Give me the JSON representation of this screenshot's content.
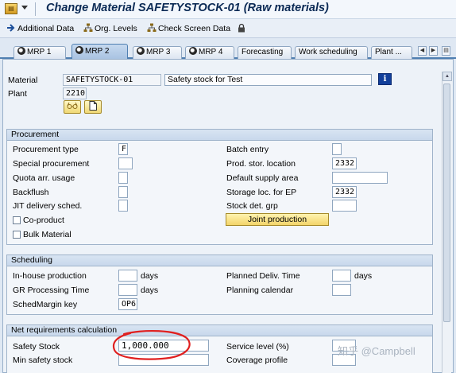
{
  "window": {
    "title": "Change Material SAFETYSTOCK-01 (Raw materials)"
  },
  "toolbar": {
    "additional_data": "Additional Data",
    "org_levels": "Org. Levels",
    "check_screen_data": "Check Screen Data"
  },
  "tabs": [
    {
      "label": "MRP 1",
      "active": false,
      "ok": true
    },
    {
      "label": "MRP 2",
      "active": true,
      "ok": true
    },
    {
      "label": "MRP 3",
      "active": false,
      "ok": true
    },
    {
      "label": "MRP 4",
      "active": false,
      "ok": true
    },
    {
      "label": "Forecasting",
      "active": false,
      "ok": false
    },
    {
      "label": "Work scheduling",
      "active": false,
      "ok": false
    },
    {
      "label": "Plant ...",
      "active": false,
      "ok": false
    }
  ],
  "header": {
    "material_label": "Material",
    "material_value": "SAFETYSTOCK-01",
    "material_desc": "Safety stock for Test",
    "plant_label": "Plant",
    "plant_value": "2210"
  },
  "procurement": {
    "title": "Procurement",
    "procurement_type_label": "Procurement type",
    "procurement_type_value": "F",
    "special_procurement_label": "Special procurement",
    "special_procurement_value": "",
    "quota_label": "Quota arr. usage",
    "quota_value": "",
    "backflush_label": "Backflush",
    "backflush_value": "",
    "jit_label": "JIT delivery sched.",
    "jit_value": "",
    "coproduct_label": "Co-product",
    "bulk_label": "Bulk Material",
    "batch_entry_label": "Batch entry",
    "batch_entry_value": "",
    "prod_stor_label": "Prod. stor. location",
    "prod_stor_value": "2332",
    "default_supply_label": "Default supply area",
    "default_supply_value": "",
    "storage_loc_ep_label": "Storage loc. for EP",
    "storage_loc_ep_value": "2332",
    "stock_det_label": "Stock det. grp",
    "stock_det_value": "",
    "joint_production_button": "Joint production"
  },
  "scheduling": {
    "title": "Scheduling",
    "inhouse_label": "In-house production",
    "inhouse_value": "",
    "inhouse_unit": "days",
    "gr_label": "GR Processing Time",
    "gr_value": "",
    "gr_unit": "days",
    "schedmargin_label": "SchedMargin key",
    "schedmargin_value": "OP6",
    "planned_deliv_label": "Planned Deliv. Time",
    "planned_deliv_value": "",
    "planned_deliv_unit": "days",
    "planning_cal_label": "Planning calendar",
    "planning_cal_value": ""
  },
  "net_requirements": {
    "title": "Net requirements calculation",
    "safety_stock_label": "Safety Stock",
    "safety_stock_value": "1,000.000",
    "min_safety_label": "Min safety stock",
    "min_safety_value": "",
    "service_level_label": "Service level (%)",
    "service_level_value": "",
    "coverage_label": "Coverage profile",
    "coverage_value": ""
  },
  "watermark": "知乎 @Campbell",
  "colors": {
    "accent": "#4f7fb1",
    "highlight_circle": "#e02020",
    "title_text": "#0b2a55"
  }
}
